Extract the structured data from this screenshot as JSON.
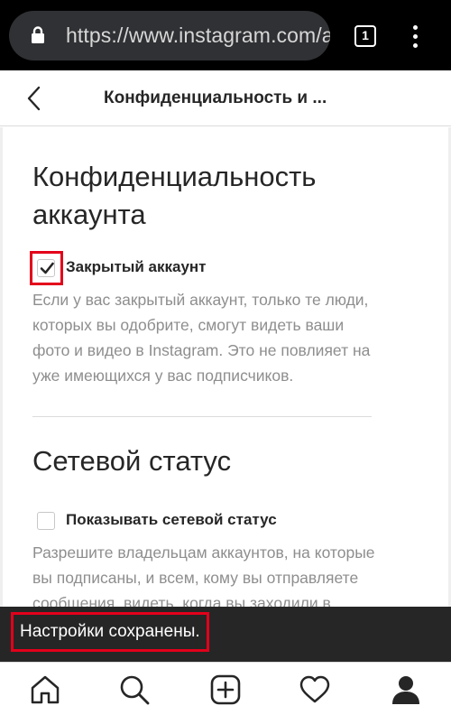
{
  "browser": {
    "url": "https://www.instagram.com/a",
    "tab_count": "1"
  },
  "header": {
    "title": "Конфиденциальность и ..."
  },
  "privacy": {
    "title_line1": "Конфиденциальность",
    "title_line2": "аккаунта",
    "checkbox_label": "Закрытый аккаунт",
    "checked": true,
    "description_lines": [
      "Если у вас закрытый аккаунт, только те люди,",
      "которых вы одобрите, смогут видеть ваши",
      "фото и видео в Instagram. Это не повлияет на",
      "уже имеющихся у вас подписчиков."
    ]
  },
  "network": {
    "title": "Сетевой статус",
    "checkbox_label": "Показывать сетевой статус",
    "checked": false,
    "description_lines": [
      "Разрешите владельцам аккаунтов, на которые",
      "вы подписаны, и всем, кому вы отправляете",
      "сообщения, видеть, когда вы заходили в"
    ]
  },
  "snackbar": {
    "message": "Настройки сохранены."
  },
  "nav": {
    "items": [
      "home-icon",
      "search-icon",
      "new-post-icon",
      "activity-icon",
      "profile-icon"
    ]
  },
  "colors": {
    "browser_bg": "#000000",
    "url_bar": "#303134",
    "text_primary": "#262626",
    "text_secondary": "#8e8e8e",
    "highlight": "#e3001b",
    "snackbar_bg": "#262626"
  }
}
